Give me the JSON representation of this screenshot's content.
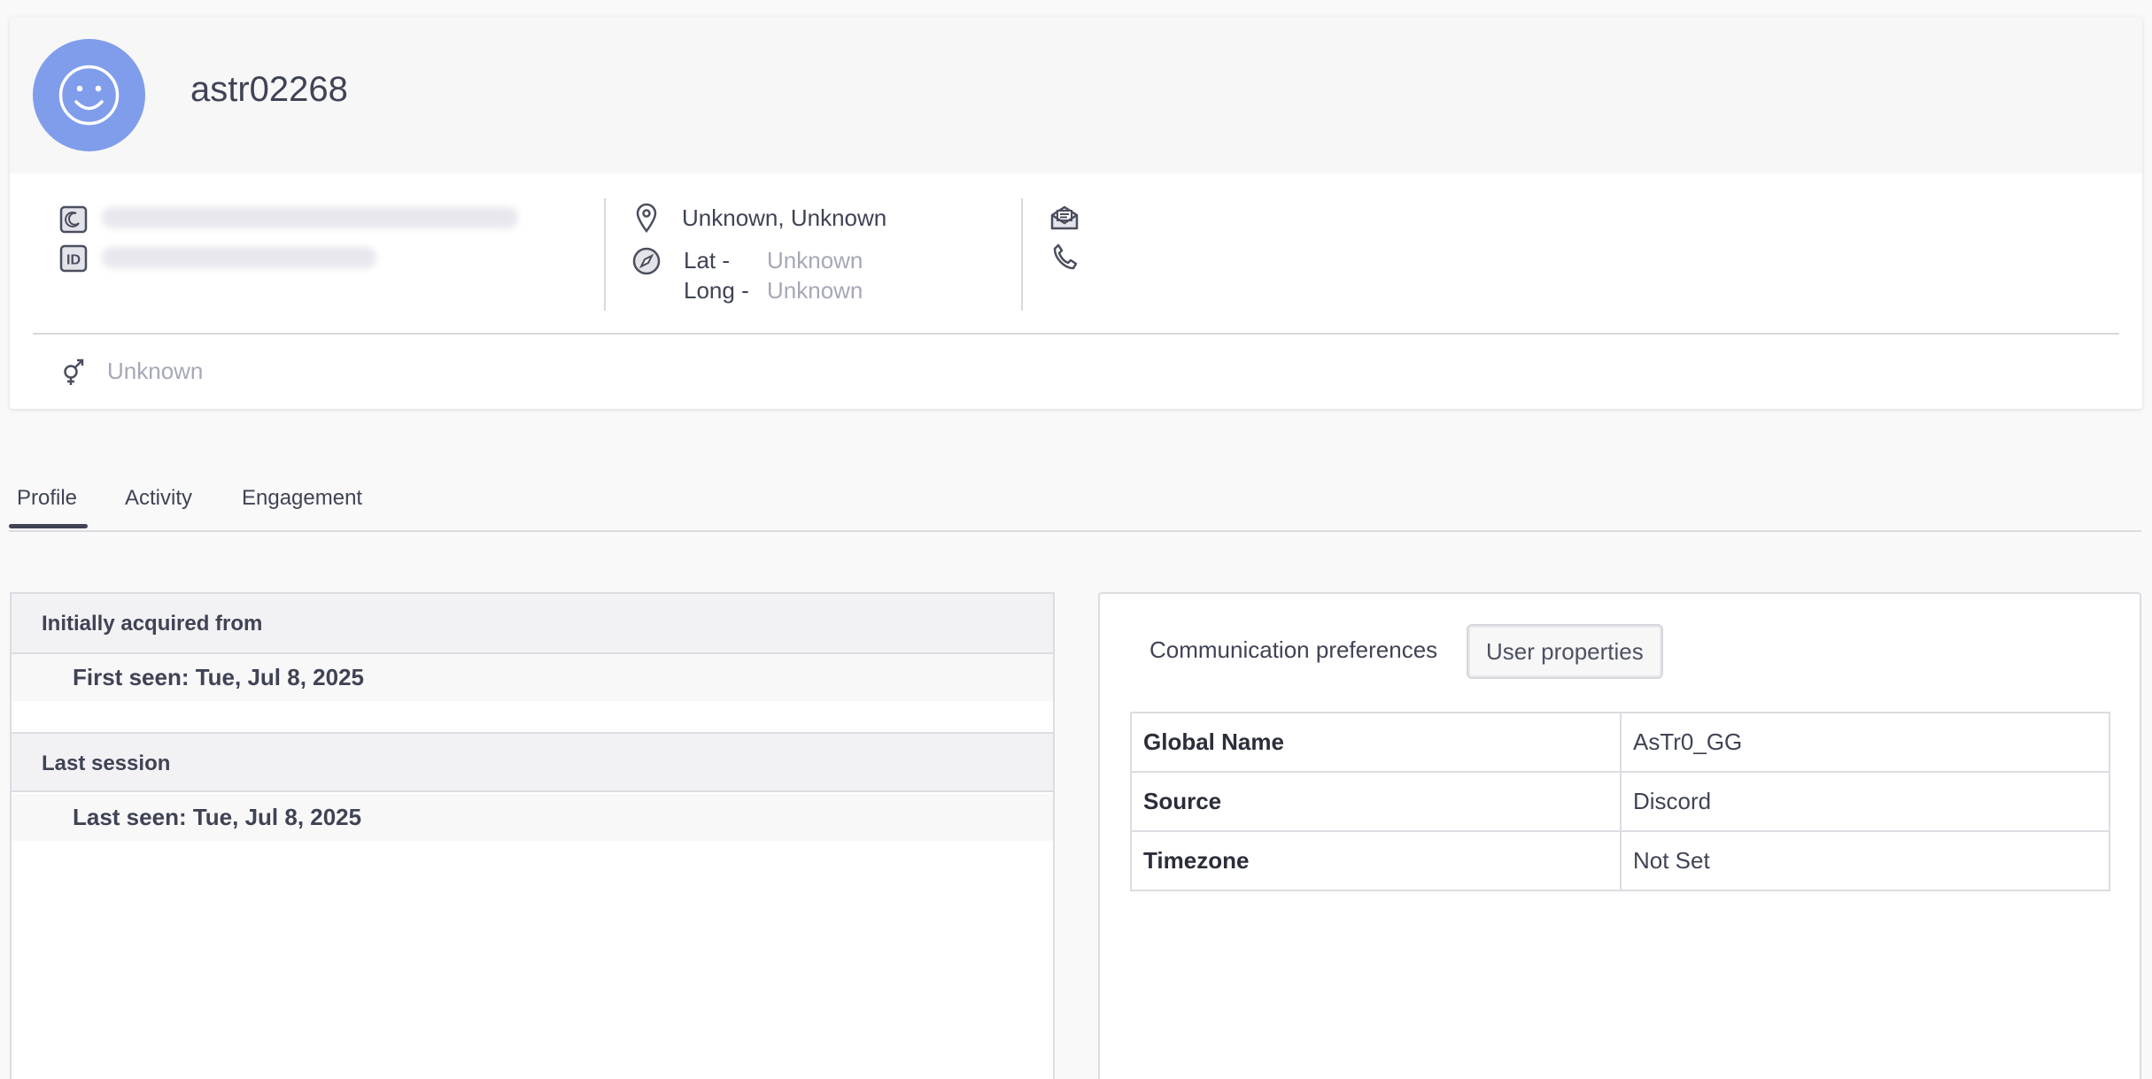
{
  "user": {
    "name": "astr02268",
    "avatar_icon": "smiley-face-icon",
    "avatar_color": "#7f9deb"
  },
  "identity": {
    "icons": [
      "moon-icon",
      "id-badge-icon"
    ]
  },
  "location": {
    "place": "Unknown, Unknown",
    "lat_label": "Lat -",
    "lat_value": "Unknown",
    "long_label": "Long -",
    "long_value": "Unknown",
    "icons": [
      "map-pin-icon",
      "compass-icon"
    ]
  },
  "contact": {
    "icons": [
      "email-icon",
      "phone-icon"
    ]
  },
  "gender": {
    "icon": "gender-icon",
    "value": "Unknown"
  },
  "tabs": [
    {
      "label": "Profile",
      "active": true
    },
    {
      "label": "Activity",
      "active": false
    },
    {
      "label": "Engagement",
      "active": false
    }
  ],
  "left_panel": {
    "acquired_title": "Initially acquired from",
    "first_seen": "First seen: Tue, Jul 8, 2025",
    "last_session_title": "Last session",
    "last_seen": "Last seen: Tue, Jul 8, 2025"
  },
  "right_panel": {
    "tabs": [
      {
        "label": "Communication preferences",
        "active": false
      },
      {
        "label": "User properties",
        "active": true
      }
    ],
    "properties": [
      {
        "key": "Global Name",
        "value": "AsTr0_GG"
      },
      {
        "key": "Source",
        "value": "Discord"
      },
      {
        "key": "Timezone",
        "value": "Not Set"
      }
    ]
  },
  "colors": {
    "accent": "#3f4354",
    "muted_text": "#a6a8b7",
    "border": "#dcdce2"
  }
}
